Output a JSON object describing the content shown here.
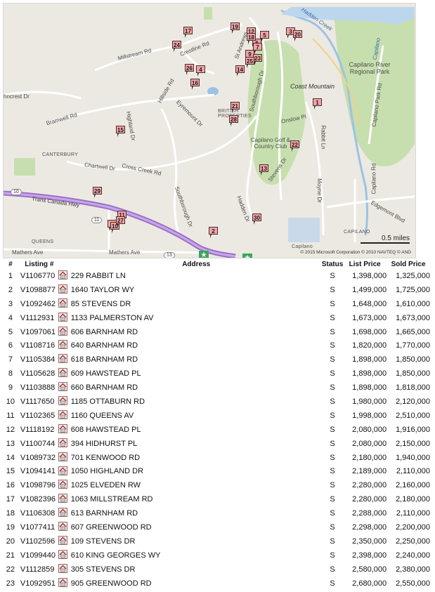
{
  "map": {
    "street_labels": [
      {
        "name": "Millstream Rd"
      },
      {
        "name": "Crestline Rd"
      },
      {
        "name": "St Andrews"
      },
      {
        "name": "Hillside Rd"
      },
      {
        "name": "Eyremount Dr"
      },
      {
        "name": "Southborough Dr"
      },
      {
        "name": "Bramwell Rd"
      },
      {
        "name": "Highland Dr"
      },
      {
        "name": "Chartwell Dr"
      },
      {
        "name": "Cross Creek Rd"
      },
      {
        "name": "Trans Canada Hwy"
      },
      {
        "name": "Southborough Dr"
      },
      {
        "name": "Hadden Dr"
      },
      {
        "name": "Stevens Dr"
      },
      {
        "name": "Onslow Pl"
      },
      {
        "name": "Rabbit Ln"
      },
      {
        "name": "Moyne Dr"
      },
      {
        "name": "Capilano Rd"
      },
      {
        "name": "Capilano Park Rd"
      },
      {
        "name": "Edgemont Blvd"
      },
      {
        "name": "Mathers Ave"
      },
      {
        "name": "Mathers Ave"
      },
      {
        "name": "hncrest Dr"
      }
    ],
    "water_labels": [
      "Hadden Creek",
      "Capilano"
    ],
    "park_labels": [
      "Capilano River Regional Park",
      "Capilano Golf & Country Club",
      "Coast Mountain",
      "BRITISH PROPERTIES"
    ],
    "area_labels": [
      "CANTERBURY",
      "QUEENS",
      "CAPILANO",
      "Capilano"
    ],
    "highway_shields": [
      "10",
      "11",
      "13"
    ],
    "markers": [
      {
        "label": "1"
      },
      {
        "label": "2"
      },
      {
        "label": "3"
      },
      {
        "label": "5"
      },
      {
        "label": "6"
      },
      {
        "label": "7"
      },
      {
        "label": "8"
      },
      {
        "label": "9"
      },
      {
        "label": "10"
      },
      {
        "label": "11"
      },
      {
        "label": "12"
      },
      {
        "label": "13"
      },
      {
        "label": "14"
      },
      {
        "label": "15"
      },
      {
        "label": "16"
      },
      {
        "label": "17"
      },
      {
        "label": "18"
      },
      {
        "label": "19"
      },
      {
        "label": "20"
      },
      {
        "label": "21"
      },
      {
        "label": "22"
      },
      {
        "label": "23"
      },
      {
        "label": "24"
      },
      {
        "label": "25"
      },
      {
        "label": "26"
      },
      {
        "label": "27"
      },
      {
        "label": "28"
      },
      {
        "label": "29"
      },
      {
        "label": "30"
      },
      {
        "label": "4"
      }
    ],
    "scale": "0.5 miles",
    "copyright": "© 2015 Microsoft Corporation   © 2010 NAVTEQ   © AND"
  },
  "table": {
    "headers": {
      "num": "#",
      "listing": "Listing #",
      "address": "Address",
      "status": "Status",
      "list_price": "List Price",
      "sold_price": "Sold Price"
    },
    "rows": [
      {
        "num": "1",
        "listing": "V1106770",
        "address": "229 RABBIT LN",
        "status": "S",
        "list_price": "1,398,000",
        "sold_price": "1,325,000"
      },
      {
        "num": "2",
        "listing": "V1098877",
        "address": "1640 TAYLOR WY",
        "status": "S",
        "list_price": "1,499,000",
        "sold_price": "1,725,000"
      },
      {
        "num": "3",
        "listing": "V1092462",
        "address": "85 STEVENS DR",
        "status": "S",
        "list_price": "1,648,000",
        "sold_price": "1,610,000"
      },
      {
        "num": "4",
        "listing": "V1112931",
        "address": "1133 PALMERSTON AV",
        "status": "S",
        "list_price": "1,673,000",
        "sold_price": "1,673,000"
      },
      {
        "num": "5",
        "listing": "V1097061",
        "address": "606 BARNHAM RD",
        "status": "S",
        "list_price": "1,698,000",
        "sold_price": "1,665,000"
      },
      {
        "num": "6",
        "listing": "V1108716",
        "address": "640 BARNHAM RD",
        "status": "S",
        "list_price": "1,820,000",
        "sold_price": "1,770,000"
      },
      {
        "num": "7",
        "listing": "V1105384",
        "address": "618 BARNHAM RD",
        "status": "S",
        "list_price": "1,898,000",
        "sold_price": "1,850,000"
      },
      {
        "num": "8",
        "listing": "V1105628",
        "address": "609 HAWSTEAD PL",
        "status": "S",
        "list_price": "1,898,000",
        "sold_price": "1,850,000"
      },
      {
        "num": "9",
        "listing": "V1103888",
        "address": "660 BARNHAM RD",
        "status": "S",
        "list_price": "1,898,000",
        "sold_price": "1,818,000"
      },
      {
        "num": "10",
        "listing": "V1117650",
        "address": "1185 OTTABURN RD",
        "status": "S",
        "list_price": "1,980,000",
        "sold_price": "2,120,000"
      },
      {
        "num": "11",
        "listing": "V1102365",
        "address": "1160 QUEENS AV",
        "status": "S",
        "list_price": "1,998,000",
        "sold_price": "2,510,000"
      },
      {
        "num": "12",
        "listing": "V1118192",
        "address": "608 HAWSTEAD PL",
        "status": "S",
        "list_price": "2,080,000",
        "sold_price": "1,916,000"
      },
      {
        "num": "13",
        "listing": "V1100744",
        "address": "394 HIDHURST PL",
        "status": "S",
        "list_price": "2,080,000",
        "sold_price": "2,150,000"
      },
      {
        "num": "14",
        "listing": "V1089732",
        "address": "701 KENWOOD RD",
        "status": "S",
        "list_price": "2,180,000",
        "sold_price": "1,940,000"
      },
      {
        "num": "15",
        "listing": "V1094141",
        "address": "1050 HIGHLAND DR",
        "status": "S",
        "list_price": "2,189,000",
        "sold_price": "2,110,000"
      },
      {
        "num": "16",
        "listing": "V1098796",
        "address": "1025 ELVEDEN RW",
        "status": "S",
        "list_price": "2,280,000",
        "sold_price": "2,160,000"
      },
      {
        "num": "17",
        "listing": "V1082396",
        "address": "1063 MILLSTREAM RD",
        "status": "S",
        "list_price": "2,280,000",
        "sold_price": "2,180,000"
      },
      {
        "num": "18",
        "listing": "V1106308",
        "address": "613 BARNHAM RD",
        "status": "S",
        "list_price": "2,288,000",
        "sold_price": "2,110,000"
      },
      {
        "num": "19",
        "listing": "V1077411",
        "address": "607 GREENWOOD RD",
        "status": "S",
        "list_price": "2,298,000",
        "sold_price": "2,200,000"
      },
      {
        "num": "20",
        "listing": "V1102596",
        "address": "109 STEVENS DR",
        "status": "S",
        "list_price": "2,350,000",
        "sold_price": "2,250,000"
      },
      {
        "num": "21",
        "listing": "V1099440",
        "address": "610 KING GEORGES WY",
        "status": "S",
        "list_price": "2,398,000",
        "sold_price": "2,240,000"
      },
      {
        "num": "22",
        "listing": "V1112859",
        "address": "305 STEVENS DR",
        "status": "S",
        "list_price": "2,580,000",
        "sold_price": "2,380,000"
      },
      {
        "num": "23",
        "listing": "V1092951",
        "address": "905 GREENWOOD RD",
        "status": "S",
        "list_price": "2,680,000",
        "sold_price": "2,550,000"
      }
    ]
  }
}
